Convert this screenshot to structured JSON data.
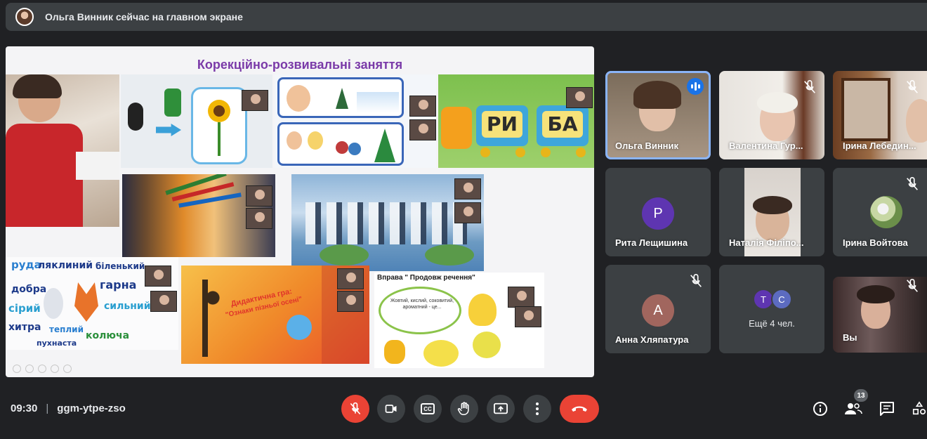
{
  "banner": {
    "text": "Ольга Винник сейчас на главном экране"
  },
  "slide": {
    "title": "Корекційно-розвивальні заняття",
    "train_letters": [
      "РИ",
      "БА"
    ],
    "words": [
      "руда",
      "ляклиний",
      "біленький",
      "добра",
      "гарна",
      "сірий",
      "сильний",
      "хитра",
      "теплий",
      "колюча",
      "пухнаста"
    ],
    "game_title_lines": [
      "Дидактична гра:",
      "\"Ознаки пізньої осені\""
    ],
    "exercise_title": "Вправа \" Продовж речення\"",
    "exercise_bubble": "Жовтий, кислий, соковитий, ароматний - це..."
  },
  "participants": [
    {
      "name": "Ольга Винник",
      "state": "speaking"
    },
    {
      "name": "Валентина Гур...",
      "state": "muted"
    },
    {
      "name": "Ірина Лебедин...",
      "state": "muted"
    },
    {
      "name": "Рита Лещишина",
      "state": "none",
      "letter": "Р",
      "color": "#5e35b1"
    },
    {
      "name": "Наталія Філіпо...",
      "state": "none"
    },
    {
      "name": "Ірина Войтова",
      "state": "muted"
    },
    {
      "name": "Анна Хляпатура",
      "state": "muted",
      "letter": "А",
      "color": "#a1665e"
    },
    {
      "name": "Ещё 4 чел.",
      "state": "none",
      "letters": [
        "Т",
        "С"
      ]
    },
    {
      "name": "Вы",
      "state": "muted"
    }
  ],
  "meeting": {
    "time": "09:30",
    "separator": "|",
    "code": "ggm-ytpe-zso"
  },
  "controls": {
    "mic": "mic-off-icon",
    "camera": "camera-icon",
    "captions_label": "CC",
    "hand": "raise-hand-icon",
    "present": "present-icon",
    "more": "more-icon",
    "end": "end-call-icon"
  },
  "right_controls": {
    "participant_count": "13"
  },
  "colors": {
    "accent": "#8ab4f8",
    "end_call": "#ea4335",
    "speaking": "#1a73e8",
    "bg": "#202124",
    "tile": "#3c4043"
  }
}
